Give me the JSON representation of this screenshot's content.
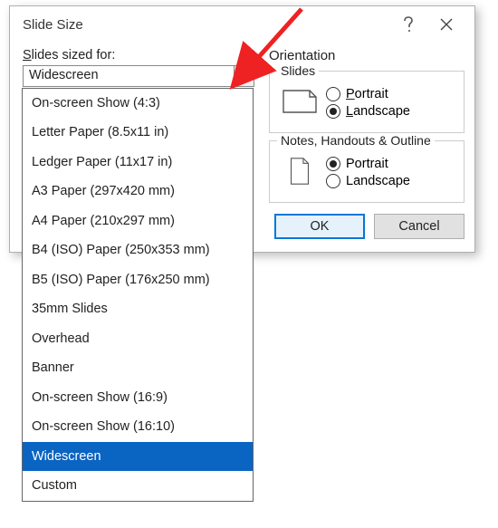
{
  "dialog": {
    "title": "Slide Size",
    "label_prefix": "S",
    "label_rest": "lides sized for:",
    "combo_value": "Widescreen",
    "orientation_label": "Orientation",
    "group_slides": "Slides",
    "group_notes": "Notes, Handouts & Outline",
    "radio_portrait_u": "P",
    "radio_portrait_rest": "ortrait",
    "radio_landscape_u": "L",
    "radio_landscape_rest": "andscape",
    "radio_portrait_plain": "Portrait",
    "radio_landscape_plain": "Landscape",
    "ok": "OK",
    "cancel": "Cancel"
  },
  "dropdown": {
    "items": [
      "On-screen Show (4:3)",
      "Letter Paper (8.5x11 in)",
      "Ledger Paper (11x17 in)",
      "A3 Paper (297x420 mm)",
      "A4 Paper (210x297 mm)",
      "B4 (ISO) Paper (250x353 mm)",
      "B5 (ISO) Paper (176x250 mm)",
      "35mm Slides",
      "Overhead",
      "Banner",
      "On-screen Show (16:9)",
      "On-screen Show (16:10)",
      "Widescreen",
      "Custom"
    ],
    "selected_index": 12
  }
}
